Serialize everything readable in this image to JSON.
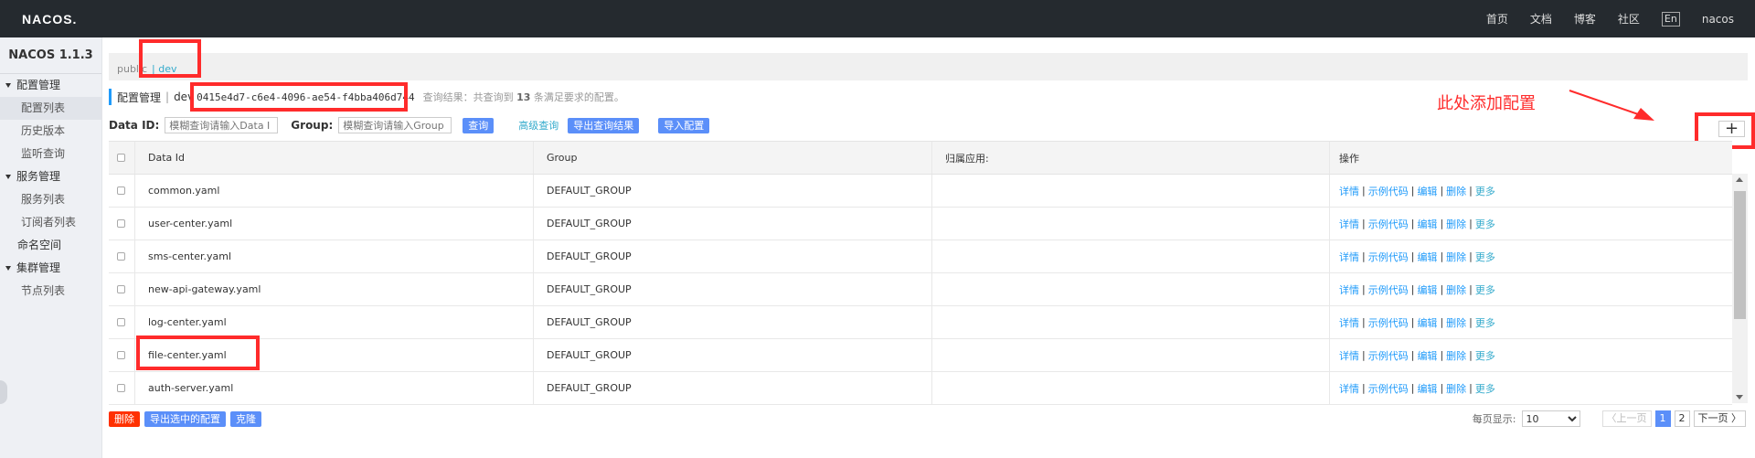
{
  "brand": {
    "logo": "NACOS."
  },
  "topnav": {
    "home": "首页",
    "docs": "文档",
    "blog": "博客",
    "community": "社区",
    "lang": "En",
    "user": "nacos"
  },
  "sidebar": {
    "version": "NACOS 1.1.3",
    "groups": [
      {
        "label": "配置管理",
        "items": [
          "配置列表",
          "历史版本",
          "监听查询"
        ]
      },
      {
        "label": "服务管理",
        "items": [
          "服务列表",
          "订阅者列表"
        ]
      },
      {
        "label": "命名空间"
      },
      {
        "label": "集群管理",
        "items": [
          "节点列表"
        ]
      }
    ]
  },
  "namespace_bar": {
    "public": "public",
    "separator": "|",
    "dev": "dev"
  },
  "config_header": {
    "title": "配置管理",
    "sep": "|",
    "ns_name": "dev",
    "ns_id": "0415e4d7-c6e4-4096-ae54-f4bba406d744",
    "result_prefix": "查询结果：共查询到",
    "result_count": "13",
    "result_suffix": "条满足要求的配置。"
  },
  "search": {
    "dataid_label": "Data ID:",
    "dataid_placeholder": "模糊查询请输入Data I",
    "group_label": "Group:",
    "group_placeholder": "模糊查询请输入Group",
    "query_btn": "查询",
    "advanced": "高级查询",
    "export_btn": "导出查询结果",
    "import_btn": "导入配置"
  },
  "annotation": {
    "text": "此处添加配置",
    "color": "#ff2b2b"
  },
  "add_button": "+",
  "table": {
    "columns": [
      "Data Id",
      "Group",
      "归属应用:",
      "操作"
    ],
    "rows": [
      {
        "data_id": "common.yaml",
        "group": "DEFAULT_GROUP",
        "app": ""
      },
      {
        "data_id": "user-center.yaml",
        "group": "DEFAULT_GROUP",
        "app": ""
      },
      {
        "data_id": "sms-center.yaml",
        "group": "DEFAULT_GROUP",
        "app": ""
      },
      {
        "data_id": "new-api-gateway.yaml",
        "group": "DEFAULT_GROUP",
        "app": ""
      },
      {
        "data_id": "log-center.yaml",
        "group": "DEFAULT_GROUP",
        "app": ""
      },
      {
        "data_id": "file-center.yaml",
        "group": "DEFAULT_GROUP",
        "app": ""
      },
      {
        "data_id": "auth-server.yaml",
        "group": "DEFAULT_GROUP",
        "app": ""
      }
    ],
    "ops": {
      "detail": "详情",
      "sample": "示例代码",
      "edit": "编辑",
      "delete": "删除",
      "more": "更多",
      "pipe": "|"
    }
  },
  "footer": {
    "delete_btn": "删除",
    "export_selected_btn": "导出选中的配置",
    "clone_btn": "克隆",
    "page_size_label": "每页显示:",
    "page_size": "10",
    "prev": "〈上一页",
    "pages": [
      "1",
      "2"
    ],
    "next": "下一页 〉"
  },
  "colors": {
    "topbar": "#252a2f",
    "primary": "#5b8ff9",
    "danger": "#ff3000",
    "link": "#209bfa",
    "highlight": "#ff2b2b"
  }
}
